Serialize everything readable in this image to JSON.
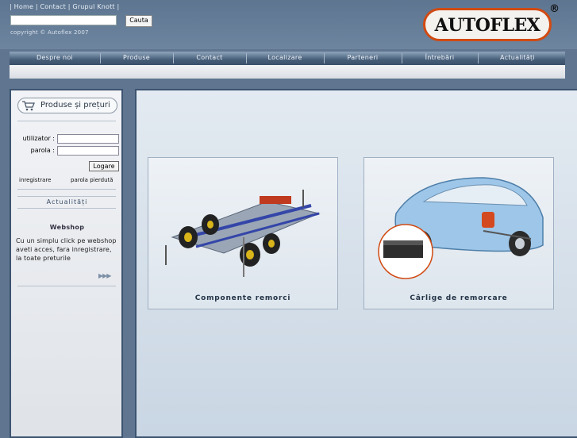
{
  "header": {
    "links": [
      "Home",
      "Contact",
      "Grupul Knott"
    ],
    "search_button": "Cauta",
    "search_value": "",
    "copyright": "copyright © Autoflex 2007",
    "logo_text": "AUTOFLEX",
    "logo_mark": "®"
  },
  "nav": {
    "items": [
      "Despre noi",
      "Produse",
      "Contact",
      "Localizare",
      "Parteneri",
      "Întrebări",
      "Actualități"
    ]
  },
  "sidebar": {
    "title": "Produse și prețuri",
    "title_icon": "cart-icon",
    "user_label": "utilizator :",
    "pass_label": "parola :",
    "login_button": "Logare",
    "register_link": "inregistrare",
    "lost_password_link": "parola pierdută",
    "news_label": "Actualități",
    "webshop_title": "Webshop",
    "webshop_text": "Cu un simplu click pe webshop aveti acces, fara inregistrare, la toate preturile",
    "more_icon": "double-arrow-icon"
  },
  "content": {
    "cards": [
      {
        "label": "Componente remorci",
        "image": "trailer-chassis-image"
      },
      {
        "label": "Cârlige de remorcare",
        "image": "car-towbar-image"
      }
    ]
  },
  "colors": {
    "accent": "#d14a12",
    "nav_bg": "#475e79",
    "border": "#3d5470"
  }
}
